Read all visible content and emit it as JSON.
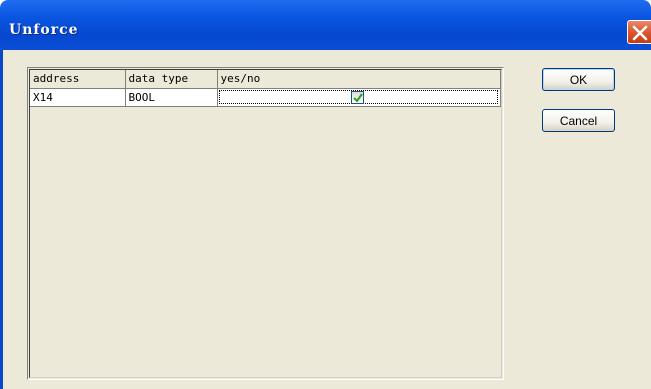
{
  "window": {
    "title": "Unforce"
  },
  "table": {
    "headers": [
      "address",
      "data type",
      "yes/no"
    ],
    "rows": [
      {
        "address": "X14",
        "data_type": "BOOL",
        "checked": true
      }
    ]
  },
  "buttons": {
    "ok_label": "OK",
    "cancel_label": "Cancel"
  },
  "icons": {
    "close": "close-x-icon",
    "check": "checkmark-icon"
  },
  "colors": {
    "titlebar": "#0a55e0",
    "client": "#ece9d8",
    "close": "#d9532c",
    "check": "#21a121"
  }
}
